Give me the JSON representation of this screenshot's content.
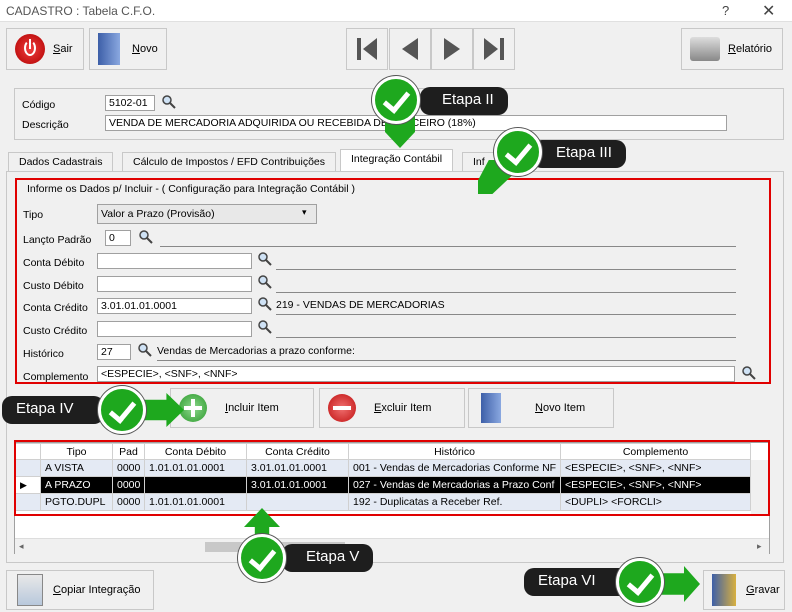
{
  "window": {
    "title": "CADASTRO : Tabela C.F.O.",
    "help": "?",
    "close": "✕"
  },
  "toolbar": {
    "sair": "Sair",
    "novo": "Novo",
    "relatorio": "Relatório"
  },
  "header": {
    "codigo_label": "Código",
    "codigo_value": "5102-01",
    "descricao_label": "Descrição",
    "descricao_value": "VENDA DE MERCADORIA ADQUIRIDA OU RECEBIDA DE TERCEIRO (18%)"
  },
  "tabs": [
    {
      "label": "Dados Cadastrais"
    },
    {
      "label": "Cálculo de Impostos / EFD Contribuições"
    },
    {
      "label": "Integração Contábil"
    },
    {
      "label": "Inf"
    }
  ],
  "form": {
    "group_title": "Informe os Dados p/ Incluir  -  ( Configuração para  Integração  Contábil )",
    "tipo_label": "Tipo",
    "tipo_value": "Valor a Prazo (Provisão)",
    "lanco_label": "Lançto Padrão",
    "lanco_value": "0",
    "conta_debito_label": "Conta Débito",
    "conta_debito_value": "",
    "custo_debito_label": "Custo Débito",
    "custo_debito_value": "",
    "conta_credito_label": "Conta Crédito",
    "conta_credito_value": "3.01.01.01.0001",
    "conta_credito_desc": "219 - VENDAS DE MERCADORIAS",
    "custo_credito_label": "Custo Crédito",
    "custo_credito_value": "",
    "historico_label": "Histórico",
    "historico_value": "27",
    "historico_desc": "Vendas de Mercadorias a prazo conforme:",
    "complemento_label": "Complemento",
    "complemento_value": "<ESPECIE>, <SNF>, <NNF>"
  },
  "actions": {
    "incluir": "Incluir Item",
    "excluir": "Excluir Item",
    "novo_item": "Novo Item"
  },
  "grid": {
    "columns": [
      "Tipo",
      "Pad",
      "Conta Débito",
      "Conta Crédito",
      "Histórico",
      "Complemento"
    ],
    "rows": [
      {
        "tipo": "A VISTA",
        "pad": "0000",
        "debito": "1.01.01.01.0001",
        "credito": "3.01.01.01.0001",
        "historico": "001 - Vendas de Mercadorias Conforme NF",
        "complemento": "<ESPECIE>, <SNF>, <NNF>"
      },
      {
        "tipo": "A PRAZO",
        "pad": "0000",
        "debito": "",
        "credito": "3.01.01.01.0001",
        "historico": "027 - Vendas de Mercadorias a Prazo Conf",
        "complemento": "<ESPECIE>, <SNF>, <NNF>"
      },
      {
        "tipo": "PGTO.DUPL",
        "pad": "0000",
        "debito": "1.01.01.01.0001",
        "credito": "",
        "historico": "192 - Duplicatas a Receber Ref.",
        "complemento": "<DUPLI> <FORCLI>"
      }
    ],
    "selected_row": 1
  },
  "footer": {
    "copiar": "Copiar Integração",
    "gravar": "Gravar"
  },
  "callouts": {
    "etapa2": "Etapa II",
    "etapa3": "Etapa III",
    "etapa4": "Etapa IV",
    "etapa5": "Etapa V",
    "etapa6": "Etapa VI"
  },
  "colors": {
    "highlight": "#e00000",
    "check": "#1ea81e",
    "callout_bg": "#1e1e1e"
  }
}
